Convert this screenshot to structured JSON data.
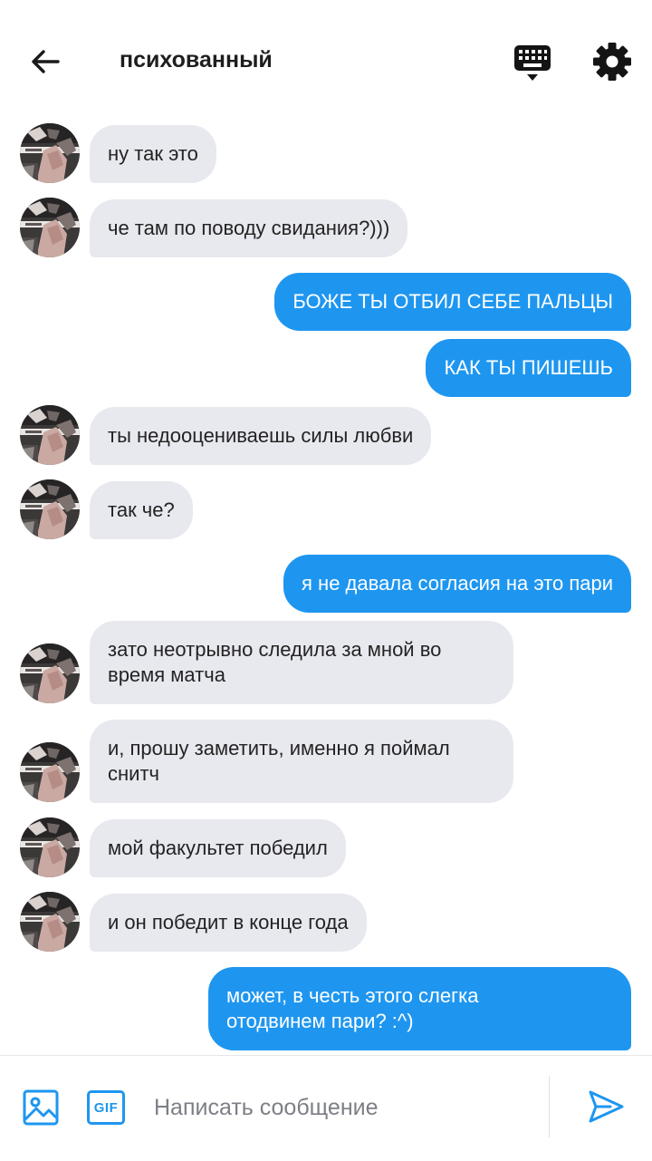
{
  "header": {
    "title": "психованный"
  },
  "messages": [
    {
      "side": "in",
      "text": "ну так это"
    },
    {
      "side": "in",
      "text": "че там по поводу свидания?)))"
    },
    {
      "side": "out",
      "text": "БОЖЕ ТЫ ОТБИЛ СЕБЕ ПАЛЬЦЫ"
    },
    {
      "side": "out",
      "text": "КАК ТЫ ПИШЕШЬ"
    },
    {
      "side": "in",
      "text": "ты недооцениваешь силы любви"
    },
    {
      "side": "in",
      "text": "так че?"
    },
    {
      "side": "out",
      "text": "я не давала согласия на это пари"
    },
    {
      "side": "in",
      "text": "зато неотрывно следила за мной во\nвремя матча"
    },
    {
      "side": "in",
      "text": "и, прошу заметить, именно я поймал\nснитч"
    },
    {
      "side": "in",
      "text": "мой факультет победил"
    },
    {
      "side": "in",
      "text": "и он победит в конце года"
    },
    {
      "side": "out",
      "text": "может, в честь этого слегка\nотодвинем пари? :^)"
    }
  ],
  "composer": {
    "placeholder": "Написать сообщение",
    "gif_label": "GIF"
  },
  "colors": {
    "outgoing_bubble": "#1e96f0",
    "incoming_bubble": "#e8e9ef",
    "accent": "#1e96f0"
  },
  "icons": [
    "back-arrow-icon",
    "keyboard-icon",
    "gear-icon",
    "image-icon",
    "gif-icon",
    "send-icon"
  ]
}
